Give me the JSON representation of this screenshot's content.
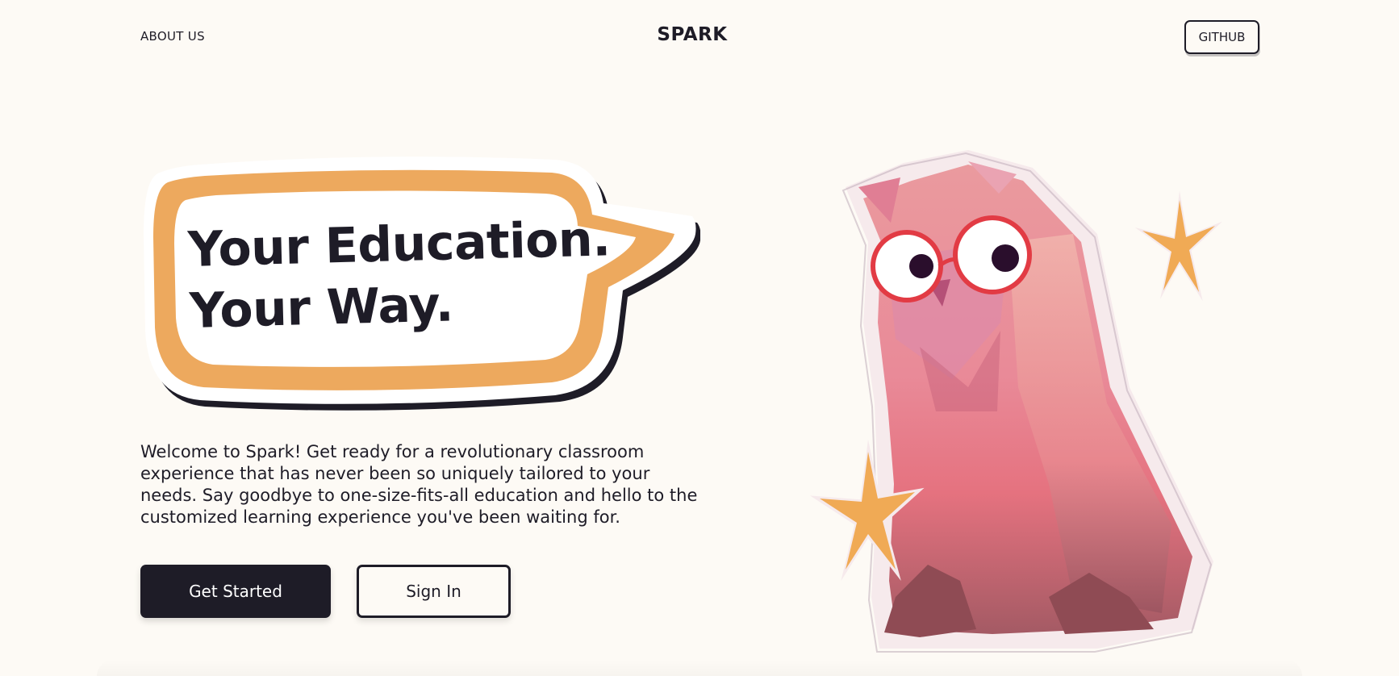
{
  "header": {
    "nav_about": "ABOUT US",
    "brand": "SPARK",
    "github_label": "GITHUB"
  },
  "hero": {
    "headline_line1": "Your Education.",
    "headline_line2": "Your Way.",
    "intro": "Welcome to Spark! Get ready for a revolutionary classroom experience that has never been so uniquely tailored to your needs. Say goodbye to one-size-fits-all education and hello to the customized learning experience you've been waiting for.",
    "primary_cta": "Get Started",
    "secondary_cta": "Sign In"
  },
  "colors": {
    "background": "#fdfaf5",
    "ink": "#1e1c27",
    "bubble_orange": "#eda95e",
    "owl_pink": "#e98a98",
    "star_orange": "#f0aa55"
  }
}
